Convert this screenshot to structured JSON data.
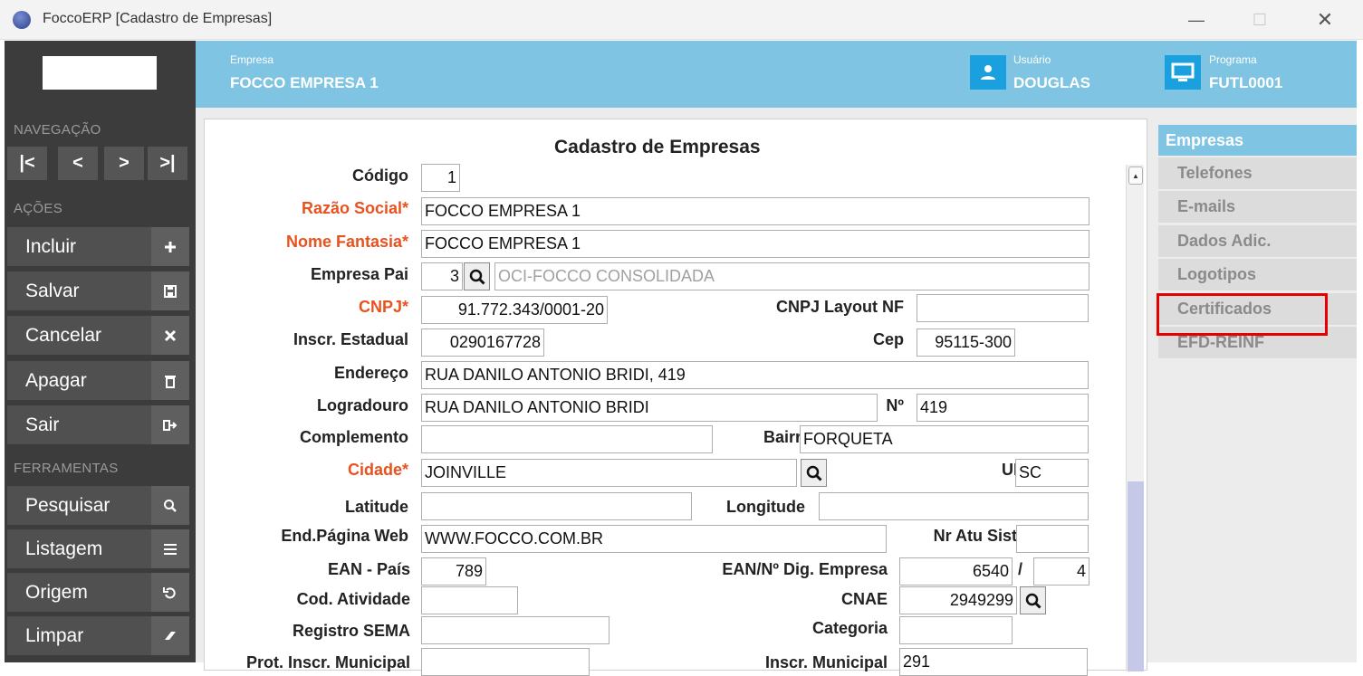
{
  "window": {
    "title": "FoccoERP [Cadastro de Empresas]",
    "min": "—",
    "max": "☐",
    "close": "✕"
  },
  "sidebar": {
    "nav_label": "NAVEGAÇÃO",
    "nav_buttons": [
      "|<",
      "<",
      ">",
      ">|"
    ],
    "actions_label": "AÇÕES",
    "actions": [
      {
        "label": "Incluir",
        "icon": "plus-icon"
      },
      {
        "label": "Salvar",
        "icon": "save-icon"
      },
      {
        "label": "Cancelar",
        "icon": "x-icon"
      },
      {
        "label": "Apagar",
        "icon": "trash-icon"
      },
      {
        "label": "Sair",
        "icon": "exit-icon"
      }
    ],
    "tools_label": "FERRAMENTAS",
    "tools": [
      {
        "label": "Pesquisar",
        "icon": "search-icon"
      },
      {
        "label": "Listagem",
        "icon": "list-icon"
      },
      {
        "label": "Origem",
        "icon": "undo-icon"
      },
      {
        "label": "Limpar",
        "icon": "eraser-icon"
      }
    ]
  },
  "header": {
    "empresa_label": "Empresa",
    "empresa_value": "FOCCO EMPRESA 1",
    "usuario_label": "Usuário",
    "usuario_value": "DOUGLAS",
    "programa_label": "Programa",
    "programa_value": "FUTL0001"
  },
  "form": {
    "title": "Cadastro de Empresas",
    "codigo_label": "Código",
    "codigo": "1",
    "razao_label": "Razão Social*",
    "razao": "FOCCO EMPRESA 1",
    "fantasia_label": "Nome Fantasia*",
    "fantasia": "FOCCO EMPRESA 1",
    "pai_label": "Empresa Pai",
    "pai_code": "3",
    "pai_name": "OCI-FOCCO CONSOLIDADA",
    "cnpj_label": "CNPJ*",
    "cnpj": "91.772.343/0001-20",
    "cnpj_nf_label": "CNPJ Layout NF",
    "cnpj_nf": "",
    "ie_label": "Inscr. Estadual",
    "ie": "0290167728",
    "cep_label": "Cep",
    "cep": "95115-300",
    "endereco_label": "Endereço",
    "endereco": "RUA DANILO ANTONIO BRIDI, 419",
    "logradouro_label": "Logradouro",
    "logradouro": "RUA DANILO ANTONIO BRIDI",
    "numero_label": "Nº",
    "numero": "419",
    "complemento_label": "Complemento",
    "complemento": "",
    "bairro_label": "Bairro",
    "bairro": "FORQUETA",
    "cidade_label": "Cidade*",
    "cidade": "JOINVILLE",
    "uf_label": "UF",
    "uf": "SC",
    "latitude_label": "Latitude",
    "latitude": "",
    "longitude_label": "Longitude",
    "longitude": "",
    "web_label": "End.Página Web",
    "web": "WWW.FOCCO.COM.BR",
    "nr_atu_label": "Nr Atu Sist",
    "nr_atu": "",
    "ean_pais_label": "EAN - País",
    "ean_pais": "789",
    "ean_emp_label": "EAN/Nº Dig. Empresa",
    "ean_emp": "6540",
    "ean_sep": "/",
    "ean_dig": "4",
    "cod_ativ_label": "Cod. Atividade",
    "cod_ativ": "",
    "cnae_label": "CNAE",
    "cnae": "2949299",
    "sema_label": "Registro SEMA",
    "sema": "",
    "categoria_label": "Categoria",
    "categoria": "",
    "prot_label": "Prot. Inscr. Municipal",
    "prot": "",
    "im_label": "Inscr. Municipal",
    "im": "291"
  },
  "right_panel": {
    "header": "Empresas",
    "items": [
      "Telefones",
      "E-mails",
      "Dados Adic.",
      "Logotipos",
      "Certificados",
      "EFD-REINF"
    ]
  }
}
